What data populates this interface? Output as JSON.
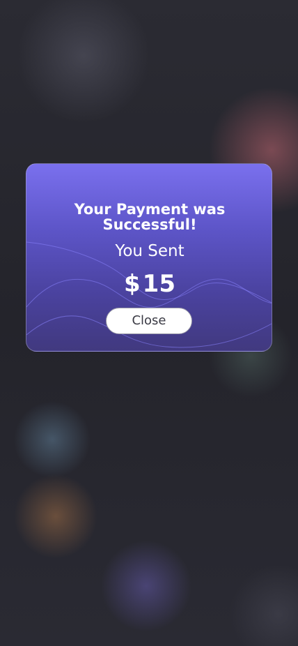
{
  "modal": {
    "title": "Your Payment was Successful!",
    "subtitle": "You Sent",
    "currency_symbol": "$",
    "amount": "15",
    "close_label": "Close"
  },
  "colors": {
    "modal_top": "#7a70ee",
    "modal_bottom": "#41397f",
    "button_bg": "#ffffff",
    "button_text": "#3a3a44"
  }
}
